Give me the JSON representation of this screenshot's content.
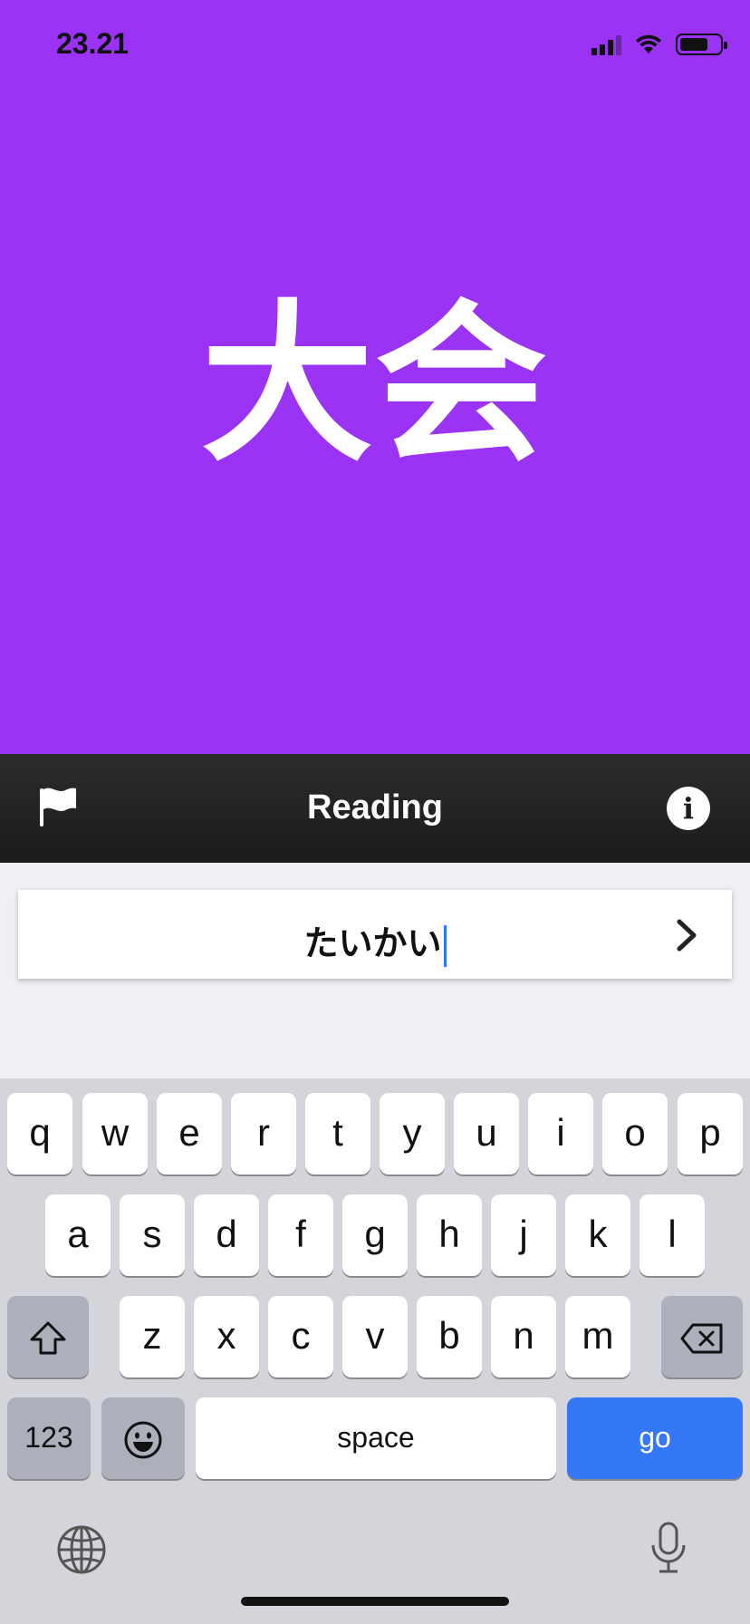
{
  "status_bar": {
    "time": "23.21"
  },
  "card": {
    "term": "大会",
    "background_color": "#9b33f5"
  },
  "nav": {
    "title": "Reading",
    "flag_icon": "flag-icon",
    "info_icon": "info-icon"
  },
  "answer": {
    "value": "たいかい",
    "submit_icon": "chevron-right-icon"
  },
  "keyboard": {
    "row1": [
      "q",
      "w",
      "e",
      "r",
      "t",
      "y",
      "u",
      "i",
      "o",
      "p"
    ],
    "row2": [
      "a",
      "s",
      "d",
      "f",
      "g",
      "h",
      "j",
      "k",
      "l"
    ],
    "row3": [
      "z",
      "x",
      "c",
      "v",
      "b",
      "n",
      "m"
    ],
    "numbers_label": "123",
    "space_label": "space",
    "go_label": "go",
    "go_color": "#3478f6"
  }
}
